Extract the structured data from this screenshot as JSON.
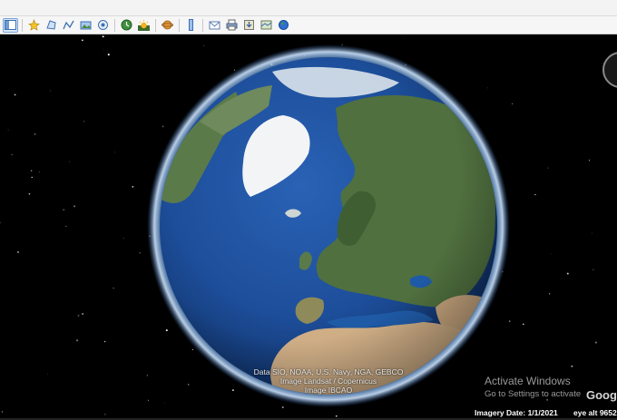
{
  "toolbar": {
    "buttons": [
      {
        "name": "hide-sidebar",
        "icon": "sidebar-icon"
      },
      {
        "name": "add-placemark",
        "icon": "pushpin-icon"
      },
      {
        "name": "add-polygon",
        "icon": "polygon-icon"
      },
      {
        "name": "add-path",
        "icon": "path-icon"
      },
      {
        "name": "add-image-overlay",
        "icon": "image-overlay-icon"
      },
      {
        "name": "record-tour",
        "icon": "tour-icon"
      },
      {
        "name": "historical-imagery",
        "icon": "clock-icon"
      },
      {
        "name": "sunlight",
        "icon": "sun-icon"
      },
      {
        "name": "switch-to-sky",
        "icon": "planet-icon"
      },
      {
        "name": "ruler",
        "icon": "ruler-icon"
      },
      {
        "name": "email",
        "icon": "envelope-icon"
      },
      {
        "name": "print",
        "icon": "printer-icon"
      },
      {
        "name": "save-image",
        "icon": "save-image-icon"
      },
      {
        "name": "view-in-maps",
        "icon": "map-icon"
      },
      {
        "name": "earth-gallery",
        "icon": "globe-icon"
      }
    ]
  },
  "view": {
    "attribution": [
      "Data SIO, NOAA, U.S. Navy, NGA, GEBCO",
      "Image Landsat / Copernicus",
      "Image IBCAO"
    ],
    "activate_title": "Activate Windows",
    "activate_sub": "Go to Settings to activate",
    "logo_text": "Goog",
    "imagery_date": "Imagery Date: 1/1/2021",
    "eye_alt": "eye alt 9652"
  },
  "colors": {
    "ocean": "#1d4e9a",
    "land": "#5b7a4a",
    "ice": "#f2f4f6",
    "desert": "#cfae86",
    "atmosphere": "#5aa0ff"
  }
}
